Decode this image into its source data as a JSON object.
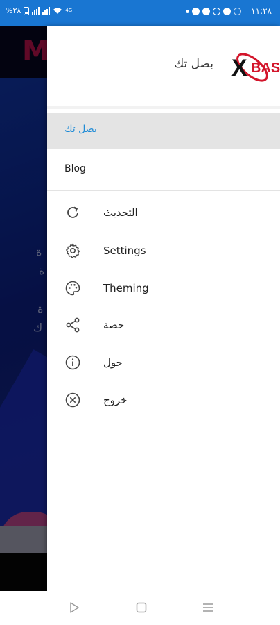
{
  "status_bar": {
    "time": "١١:٢٨",
    "battery": "%٢٨",
    "network_badge": "4G",
    "notification_icons": [
      "dot-icon",
      "facebook-icon",
      "facebook-icon",
      "vpn-icon",
      "messenger-icon",
      "wifi-alt-icon"
    ]
  },
  "background": {
    "brand_letter": "M"
  },
  "drawer": {
    "brand_title": "بصل تك",
    "logo_text": "BAS",
    "active_item": {
      "label": "بصل تك"
    },
    "blog_item": {
      "label": "Blog"
    },
    "items": [
      {
        "label": "التحديث",
        "icon": "refresh-icon"
      },
      {
        "label": "Settings",
        "icon": "gear-icon"
      },
      {
        "label": "Theming",
        "icon": "palette-icon"
      },
      {
        "label": "حصة",
        "icon": "share-icon"
      },
      {
        "label": "حول",
        "icon": "info-icon"
      },
      {
        "label": "خروج",
        "icon": "close-circle-icon"
      }
    ]
  },
  "colors": {
    "status_bar": "#1976d2",
    "active_text": "#1f8bd6",
    "active_bg": "#e4e4e4",
    "logo_red": "#d3152b"
  },
  "navbar": {
    "buttons": [
      "back-icon",
      "home-icon",
      "recents-icon"
    ]
  }
}
